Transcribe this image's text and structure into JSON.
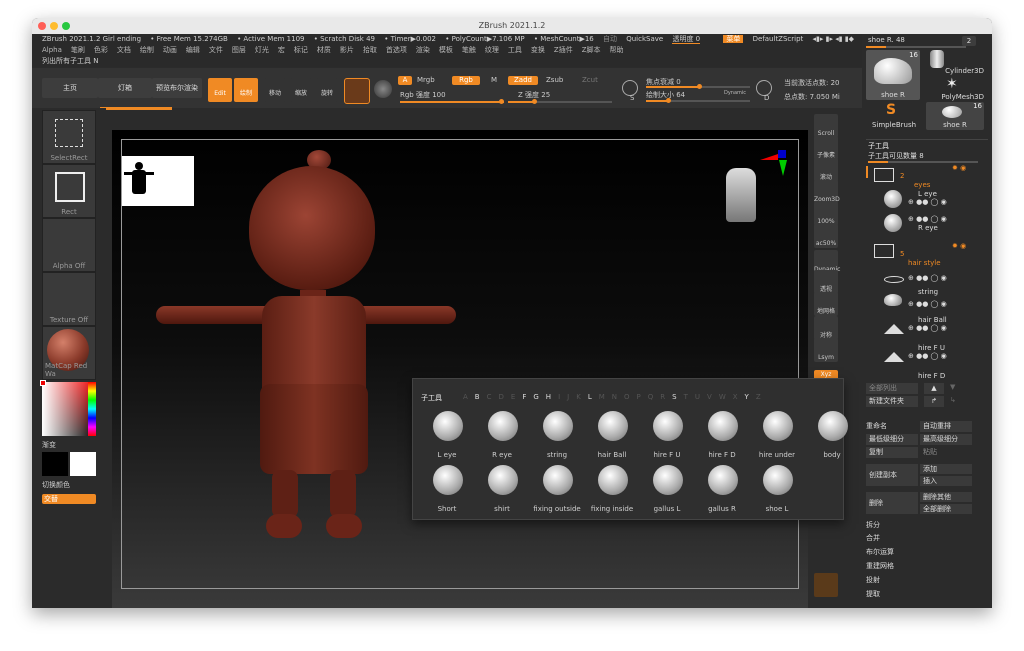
{
  "window": {
    "title": "ZBrush 2021.1.2"
  },
  "statusbar": {
    "app": "ZBrush 2021.1.2 Girl ending",
    "free_mem": "• Free Mem 15.274GB",
    "active_mem": "• Active Mem 1109",
    "scratch": "• Scratch Disk 49",
    "timer": "• Timer▶0.002",
    "polycount": "• PolyCount▶7.106 MP",
    "meshcount": "• MeshCount▶16",
    "autosave": "自动",
    "quicksave": "QuickSave",
    "transparency": "透明度 0",
    "menu_btn": "菜单",
    "script": "DefaultZScript"
  },
  "menubar": [
    "Alpha",
    "笔刷",
    "色彩",
    "文档",
    "绘制",
    "动画",
    "编辑",
    "文件",
    "图层",
    "灯光",
    "宏",
    "标记",
    "材质",
    "影片",
    "拾取",
    "首选项",
    "渲染",
    "模板",
    "笔触",
    "纹理",
    "工具",
    "变换",
    "Z插件",
    "Z脚本",
    "帮助"
  ],
  "breadcrumb": "列出所有子工具 N",
  "toolbar": {
    "home": "主页",
    "lightbox": "灯箱",
    "preview": "预览布尔渲染",
    "edit": "Edit",
    "draw": "绘制",
    "move": "移动",
    "scale": "缩放",
    "rotate": "旋转",
    "a": "A",
    "mrgb": "Mrgb",
    "rgb": "Rgb",
    "m": "M",
    "zadd": "Zadd",
    "zsub": "Zsub",
    "zcut": "Zcut",
    "rgb_strength": "Rgb 强度 100",
    "z_strength": "Z 强度 25",
    "focal": "焦点衰减 0",
    "draw_size": "绘制大小 64",
    "dynamic": "Dynamic",
    "s": "S",
    "d": "D",
    "active_points": "当前激活点数: 20",
    "total_points": "总点数: 7.050 Mi"
  },
  "leftpanel": {
    "selectrect": "SelectRect",
    "rect": "Rect",
    "alpha_off": "Alpha Off",
    "texture_off": "Texture Off",
    "matcap": "MatCap Red Wa",
    "gradient": "渐变",
    "switch_color": "切换颜色",
    "alternate": "交替"
  },
  "righttools": [
    "Scroll",
    "子像素",
    "滚动",
    "Zoom3D",
    "100%",
    "ac50%",
    "Dynamic",
    "透视",
    "地网格",
    "对称",
    "Lsym",
    "Xyz"
  ],
  "rightpanel": {
    "draw_size": "shoe R. 48",
    "draw_size_val": "2",
    "tools": [
      {
        "name": "shoe R",
        "badge": "16"
      },
      {
        "name": "Cylinder3D",
        "badge": ""
      },
      {
        "name": "PolyMesh3D",
        "badge": ""
      },
      {
        "name": "SimpleBrush",
        "badge": ""
      },
      {
        "name": "shoe R",
        "badge": "16"
      }
    ],
    "subtool_header": "子工具",
    "visible_count": "子工具可见数量 8",
    "folder1_count": "2",
    "folder1_name": "eyes",
    "items": [
      "L eye",
      "R eye"
    ],
    "folder2_count": "5",
    "folder2_name": "hair style",
    "items2": [
      "string",
      "hair Ball",
      "hire F U",
      "hire F D"
    ],
    "list_all": "全部列出",
    "new_folder": "新建文件夹",
    "rename": "重命名",
    "auto_reorder": "自动重排",
    "lowest_res": "最低级细分",
    "highest_res": "最高级细分",
    "copy": "复制",
    "paste": "粘贴",
    "copy_insert": "创建副本",
    "append": "添加",
    "insert": "插入",
    "delete": "删除",
    "delete_other": "删除其他",
    "delete_all": "全部删除",
    "split": "拆分",
    "merge": "合并",
    "boolean": "布尔运算",
    "remesh": "重建网格",
    "project": "投射",
    "extract": "提取"
  },
  "popup": {
    "title": "子工具",
    "letters": [
      "A",
      "B",
      "C",
      "D",
      "E",
      "F",
      "G",
      "H",
      "I",
      "J",
      "K",
      "L",
      "M",
      "N",
      "O",
      "P",
      "Q",
      "R",
      "S",
      "T",
      "U",
      "V",
      "W",
      "X",
      "Y",
      "Z"
    ],
    "row1": [
      "L eye",
      "R eye",
      "string",
      "hair Ball",
      "hire F U",
      "hire F D",
      "hire under",
      "body"
    ],
    "row2": [
      "Short",
      "shirt",
      "fixing outside",
      "fixing inside",
      "gallus L",
      "gallus R",
      "shoe L"
    ]
  }
}
